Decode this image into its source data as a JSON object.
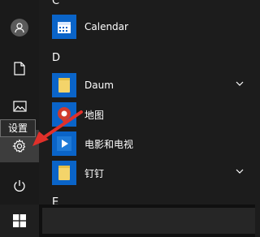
{
  "rail": {
    "user_icon": "user-avatar-icon",
    "documents_icon": "document-icon",
    "pictures_icon": "pictures-icon",
    "settings_icon": "gear-icon",
    "power_icon": "power-icon",
    "tooltip": "设置"
  },
  "app_list": {
    "sections": [
      {
        "letter": "C",
        "apps": [
          {
            "label": "Calendar",
            "icon": "calendar-icon",
            "tile_color": "#0a64c8"
          }
        ]
      },
      {
        "letter": "D",
        "apps": [
          {
            "label": "Daum",
            "icon": "folder-icon",
            "tile_color": "#0a64c8",
            "expandable": true
          },
          {
            "label": "地图",
            "icon": "map-pin-icon",
            "tile_color": "#0a64c8"
          },
          {
            "label": "电影和电视",
            "icon": "play-icon",
            "tile_color": "#0a64c8"
          },
          {
            "label": "钉钉",
            "icon": "folder-icon",
            "tile_color": "#0a64c8",
            "expandable": true
          }
        ]
      },
      {
        "letter": "E",
        "apps": []
      }
    ]
  },
  "taskbar": {
    "start_icon": "windows-logo-icon"
  },
  "colors": {
    "accent": "#0a64c8",
    "arrow": "#e0302a",
    "folder": "#f4d46a"
  }
}
